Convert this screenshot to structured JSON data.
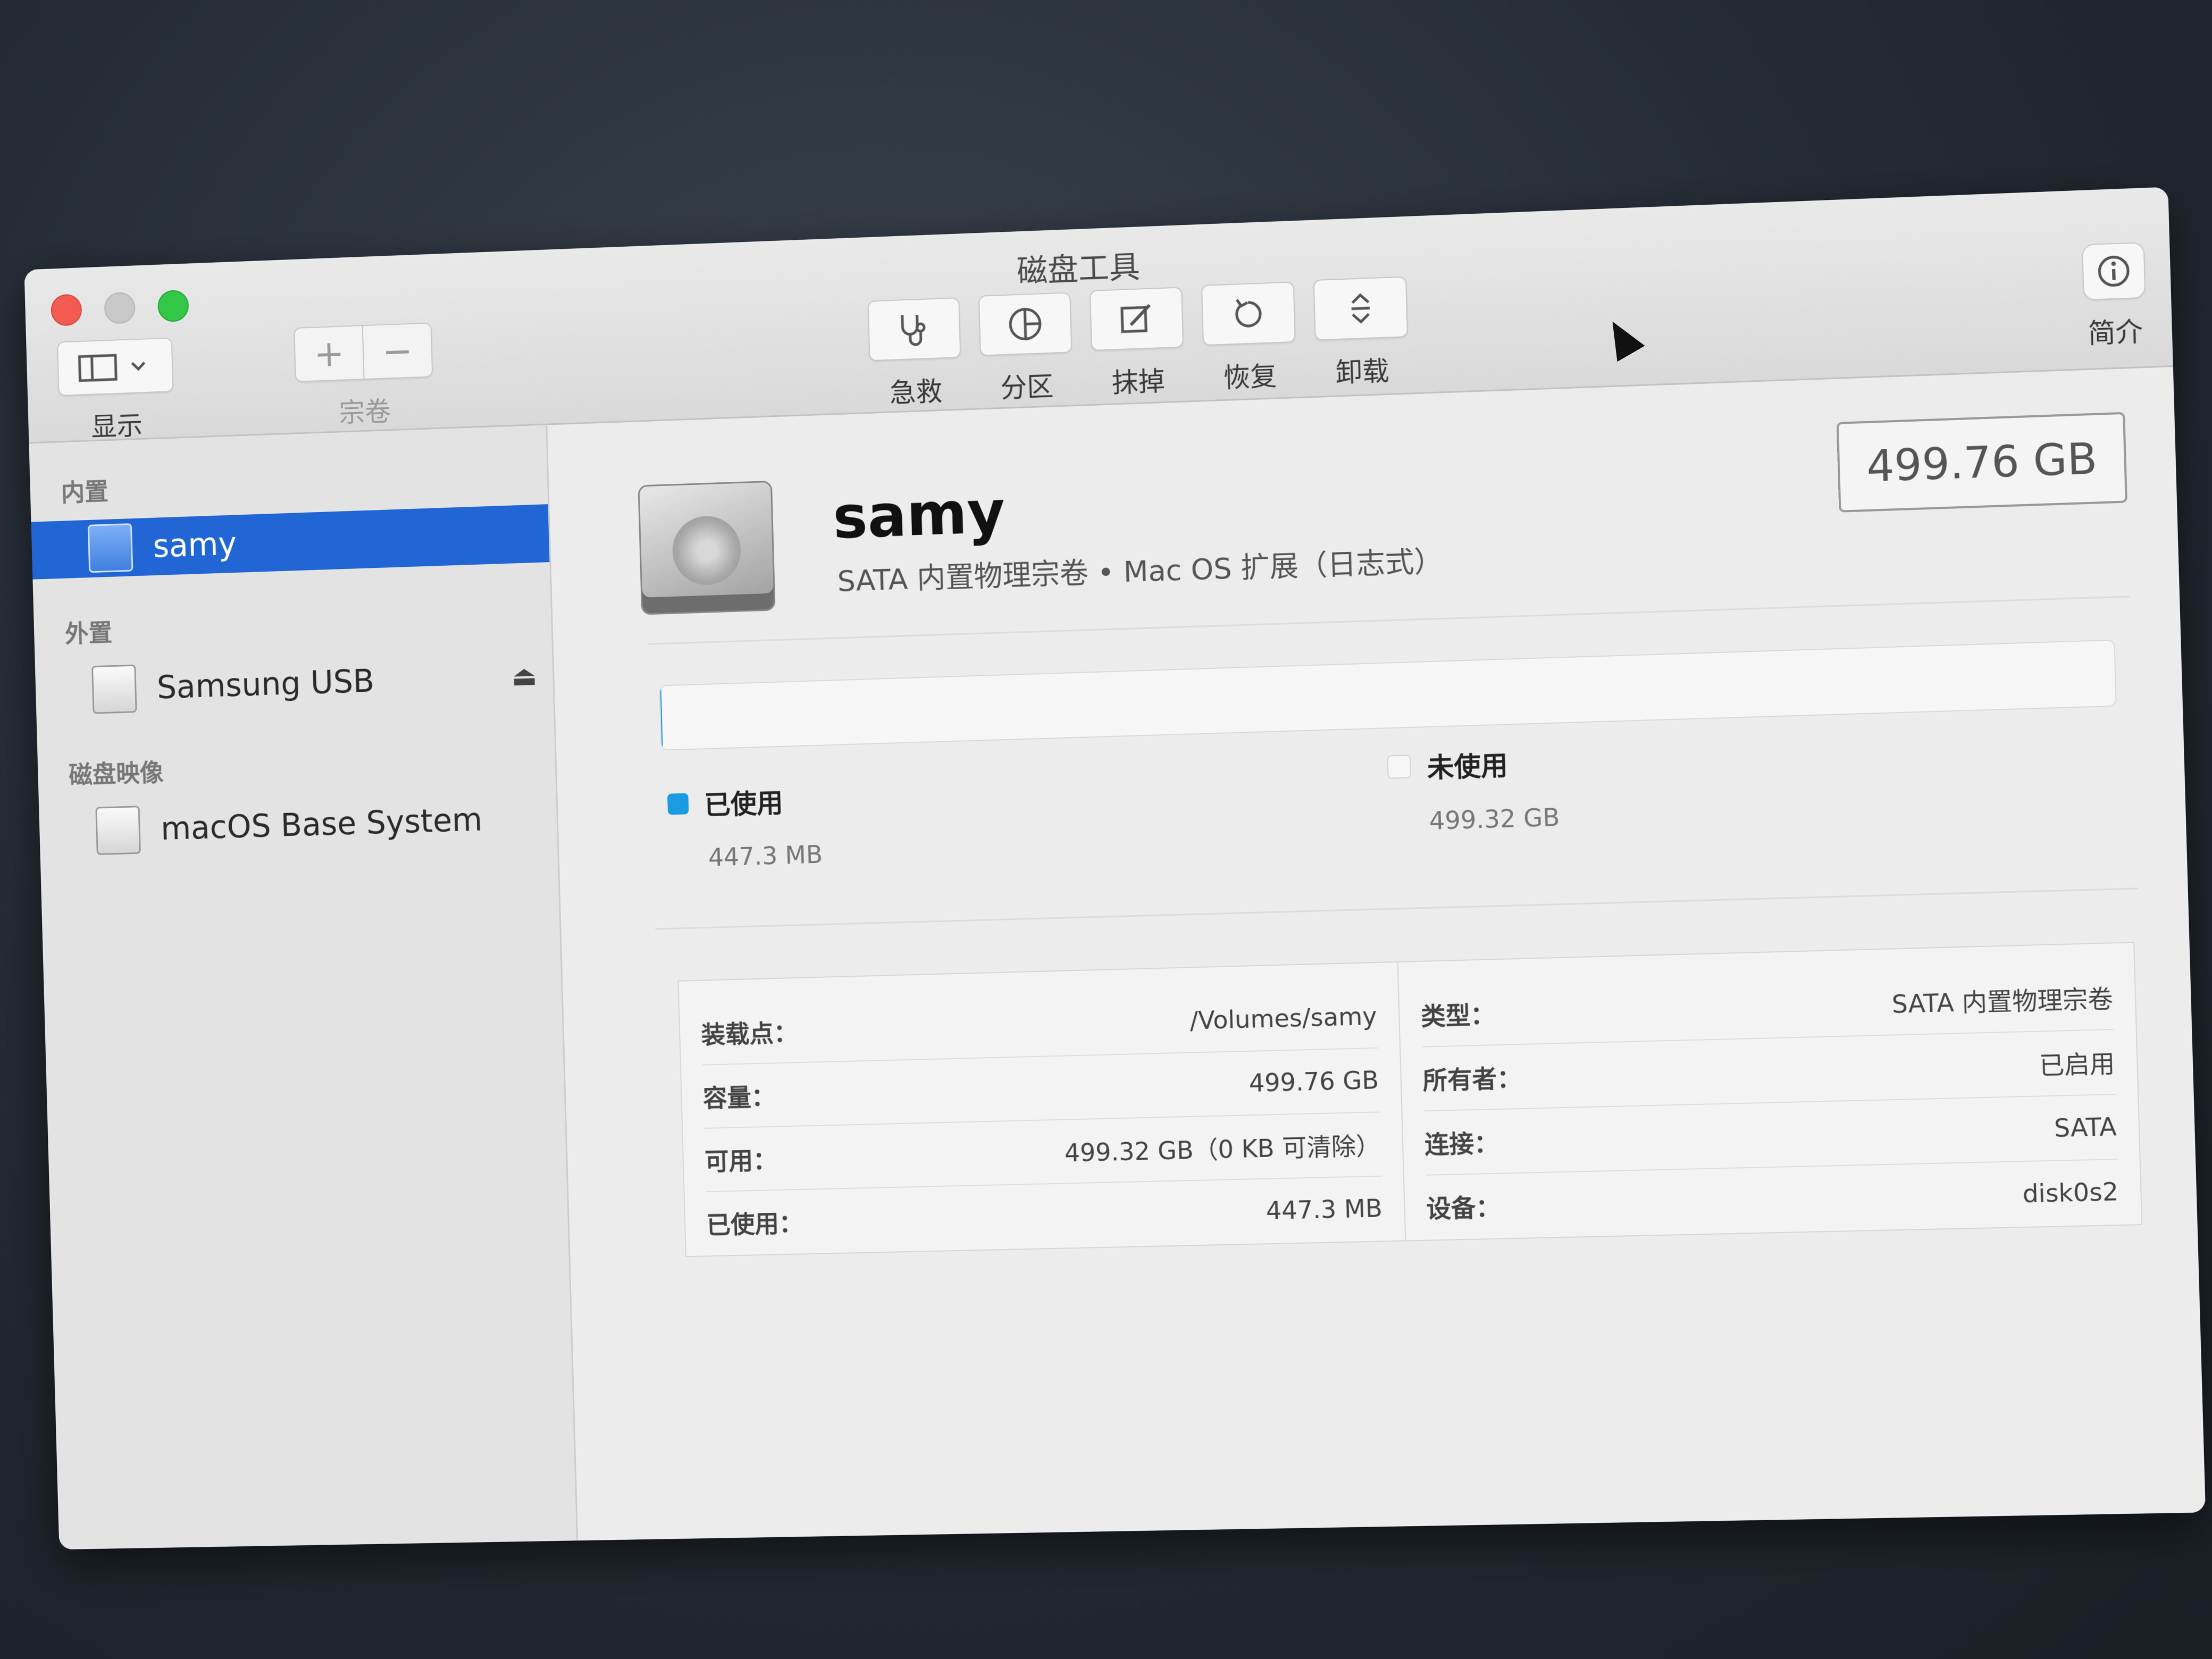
{
  "window": {
    "title": "磁盘工具"
  },
  "toolbar": {
    "view_label": "显示",
    "volume_label": "宗卷",
    "volume_add": "+",
    "volume_remove": "−",
    "tools": [
      {
        "label": "急救",
        "icon": "stethoscope-icon"
      },
      {
        "label": "分区",
        "icon": "pie-icon"
      },
      {
        "label": "抹掉",
        "icon": "erase-icon"
      },
      {
        "label": "恢复",
        "icon": "restore-icon"
      },
      {
        "label": "卸载",
        "icon": "unmount-icon"
      }
    ],
    "info_label": "简介"
  },
  "sidebar": {
    "sections": [
      {
        "header": "内置",
        "items": [
          {
            "label": "samy",
            "selected": true
          }
        ]
      },
      {
        "header": "外置",
        "items": [
          {
            "label": "Samsung USB",
            "eject": "⏏"
          }
        ]
      },
      {
        "header": "磁盘映像",
        "items": [
          {
            "label": "macOS Base System"
          }
        ]
      }
    ]
  },
  "volume": {
    "name": "samy",
    "subtitle": "SATA 内置物理宗卷 • Mac OS 扩展（日志式）",
    "size": "499.76 GB"
  },
  "usage": {
    "used_fraction": 0.0009,
    "used_color": "#1a9be2",
    "free_color": "#f6f6f6",
    "used_label": "已使用",
    "used_value": "447.3 MB",
    "free_label": "未使用",
    "free_value": "499.32 GB"
  },
  "details": {
    "left": [
      {
        "key": "装载点：",
        "value": "/Volumes/samy"
      },
      {
        "key": "容量：",
        "value": "499.76 GB"
      },
      {
        "key": "可用：",
        "value": "499.32 GB（0 KB 可清除）"
      },
      {
        "key": "已使用：",
        "value": "447.3 MB"
      }
    ],
    "right": [
      {
        "key": "类型：",
        "value": "SATA 内置物理宗卷"
      },
      {
        "key": "所有者：",
        "value": "已启用"
      },
      {
        "key": "连接：",
        "value": "SATA"
      },
      {
        "key": "设备：",
        "value": "disk0s2"
      }
    ]
  }
}
